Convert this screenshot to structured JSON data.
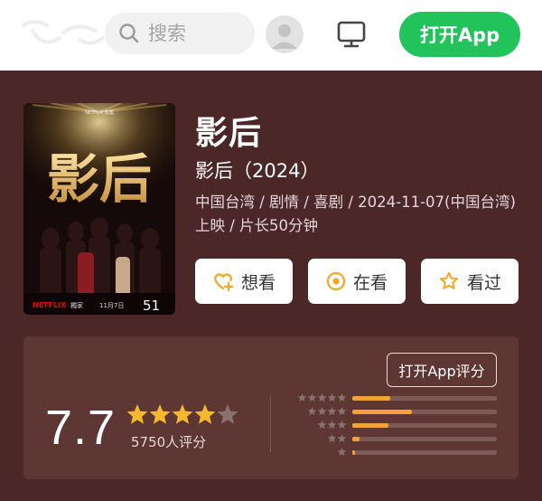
{
  "header": {
    "search_placeholder": "搜索",
    "open_app": "打开App",
    "icons": {
      "logo": "douban-logo",
      "search": "search-icon",
      "avatar": "user-avatar-icon",
      "monitor": "monitor-icon"
    }
  },
  "movie": {
    "title": "影后",
    "subtitle": "影后（2024）",
    "meta": "中国台湾 / 剧情 / 喜剧 / 2024-11-07(中国台湾)上映 / 片长50分钟",
    "poster": {
      "title_text": "影后",
      "brand_top": "NETFLIX 影集",
      "brand_bottom": "NETFLIX",
      "bottom_label": "獨家",
      "date_label": "11月7日",
      "big_number": "51"
    },
    "actions": [
      {
        "label": "想看",
        "icon": "heart-plus-icon"
      },
      {
        "label": "在看",
        "icon": "target-icon"
      },
      {
        "label": "看过",
        "icon": "star-outline-icon"
      }
    ]
  },
  "rating": {
    "rate_button": "打开App评分",
    "score": "7.7",
    "stars": 4,
    "count": "5750人评分",
    "distribution": [
      {
        "stars": 5,
        "fraction": 0.26
      },
      {
        "stars": 4,
        "fraction": 0.41
      },
      {
        "stars": 3,
        "fraction": 0.25
      },
      {
        "stars": 2,
        "fraction": 0.05
      },
      {
        "stars": 1,
        "fraction": 0.02
      }
    ],
    "colors": {
      "filled_star": "#f5b82e",
      "empty_star": "#8a7170",
      "bar_fill": "#f2a13b",
      "bar_track": "#7d5a58"
    }
  }
}
